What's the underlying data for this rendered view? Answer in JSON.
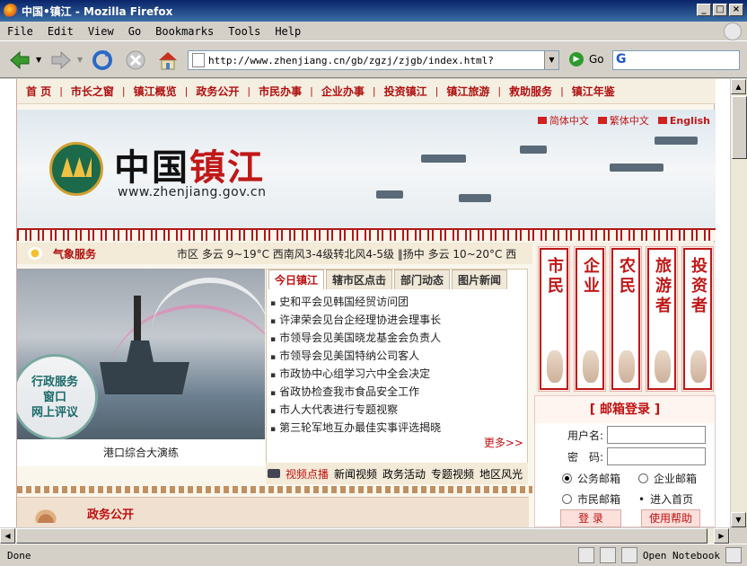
{
  "window": {
    "title": "中国•镇江 - Mozilla Firefox"
  },
  "menubar": [
    "File",
    "Edit",
    "View",
    "Go",
    "Bookmarks",
    "Tools",
    "Help"
  ],
  "toolbar": {
    "url": "http://www.zhenjiang.cn/gb/zgzj/zjgb/index.html?",
    "go_label": "Go"
  },
  "status": {
    "text": "Done",
    "notebook": "Open Notebook"
  },
  "site": {
    "nav": [
      "首 页",
      "市长之窗",
      "镇江概览",
      "政务公开",
      "市民办事",
      "企业办事",
      "投资镇江",
      "镇江旅游",
      "救助服务",
      "镇江年鉴"
    ],
    "languages": [
      "简体中文",
      "繁体中文",
      "English"
    ],
    "logo_cn_black": "中国",
    "logo_cn_red": "镇江",
    "logo_url": "www.zhenjiang.gov.cn",
    "weather_label": "气象服务",
    "weather_text": "市区 多云 9~19°C 西南风3-4级转北风4-5级 ‖扬中 多云 10~20°C 西",
    "photo_badge": [
      "行政服务",
      "窗口",
      "网上评议"
    ],
    "photo_caption": "港口综合大演练",
    "tabs": [
      "今日镇江",
      "辖市区点击",
      "部门动态",
      "图片新闻"
    ],
    "news": [
      "史和平会见韩国经贸访问团",
      "许津荣会见台企经理协进会理事长",
      "市领导会见美国晓龙基金会负责人",
      "市领导会见美国特纳公司客人",
      "市政协中心组学习六中全会决定",
      "省政协检查我市食品安全工作",
      "市人大代表进行专题视察",
      "第三轮军地互办最佳实事评选揭晓"
    ],
    "more": "更多>>",
    "video_links": [
      "视频点播",
      "新闻视频",
      "政务活动",
      "专题视频",
      "地区风光"
    ],
    "section_title": "政务公开",
    "portals": [
      "市民",
      "企业",
      "农民",
      "旅游者",
      "投资者"
    ],
    "login": {
      "title": "[ 邮箱登录 ]",
      "username_label": "用户名:",
      "password_label": "密　码:",
      "radios": [
        "公务邮箱",
        "企业邮箱",
        "市民邮箱",
        "进入首页"
      ],
      "login_btn": "登 录",
      "help_btn": "使用帮助"
    }
  }
}
